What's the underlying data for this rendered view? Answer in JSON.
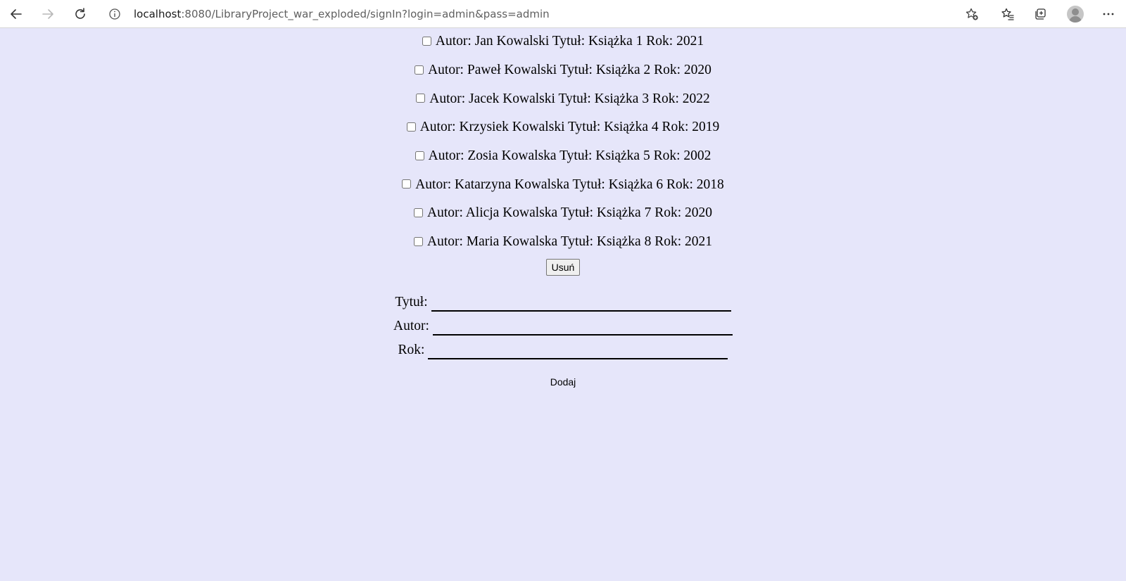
{
  "browser": {
    "url_host": "localhost",
    "url_path": ":8080/LibraryProject_war_exploded/signIn?login=admin&pass=admin",
    "icons": {
      "back": "back-arrow-icon",
      "forward": "forward-arrow-icon",
      "refresh": "refresh-icon",
      "site_info": "info-icon",
      "add_favorite": "star-plus-icon",
      "favorites": "favorites-list-icon",
      "collections": "collections-icon",
      "profile": "profile-avatar-icon",
      "menu": "more-menu-icon"
    }
  },
  "page": {
    "background": "#e6e6fa",
    "books": [
      {
        "label": "Autor: Jan Kowalski Tytuł: Książka 1 Rok: 2021",
        "checked": false
      },
      {
        "label": "Autor: Paweł Kowalski Tytuł: Książka 2 Rok: 2020",
        "checked": false
      },
      {
        "label": "Autor: Jacek Kowalski Tytuł: Książka 3 Rok: 2022",
        "checked": false
      },
      {
        "label": "Autor: Krzysiek Kowalski Tytuł: Książka 4 Rok: 2019",
        "checked": false
      },
      {
        "label": "Autor: Zosia Kowalska Tytuł: Książka 5 Rok: 2002",
        "checked": false
      },
      {
        "label": "Autor: Katarzyna Kowalska Tytuł: Książka 6 Rok: 2018",
        "checked": false
      },
      {
        "label": "Autor: Alicja Kowalska Tytuł: Książka 7 Rok: 2020",
        "checked": false
      },
      {
        "label": "Autor: Maria Kowalska Tytuł: Książka 8 Rok: 2021",
        "checked": false
      }
    ],
    "delete_label": "Usuń",
    "form": {
      "title_label": "Tytuł:",
      "title_value": "",
      "author_label": "Autor:",
      "author_value": "",
      "year_label": "Rok:",
      "year_value": ""
    },
    "add_label": "Dodaj"
  }
}
